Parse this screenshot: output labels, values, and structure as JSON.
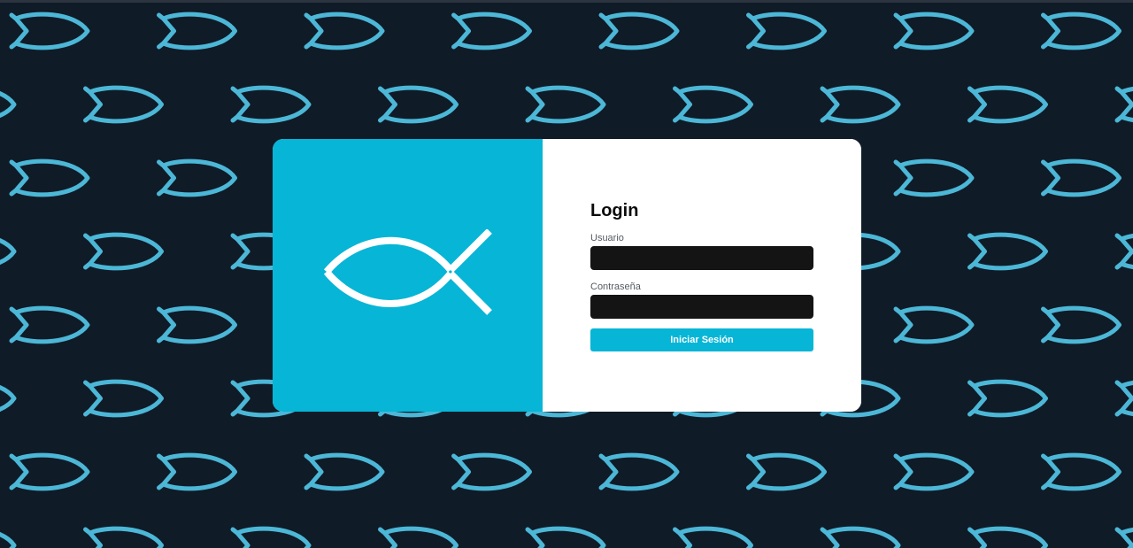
{
  "login": {
    "title": "Login",
    "username_label": "Usuario",
    "username_value": "",
    "password_label": "Contraseña",
    "password_value": "",
    "submit_label": "Iniciar Sesión"
  },
  "branding": {
    "logo_icon": "ichthys-fish-icon",
    "background_pattern_icon": "ichthys-fish-icon"
  },
  "colors": {
    "background": "#101b28",
    "pattern_fish": "#4cb7d6",
    "accent": "#07b5d6",
    "card": "#ffffff",
    "input_fill": "#141414",
    "logo_stroke": "#ffffff"
  }
}
